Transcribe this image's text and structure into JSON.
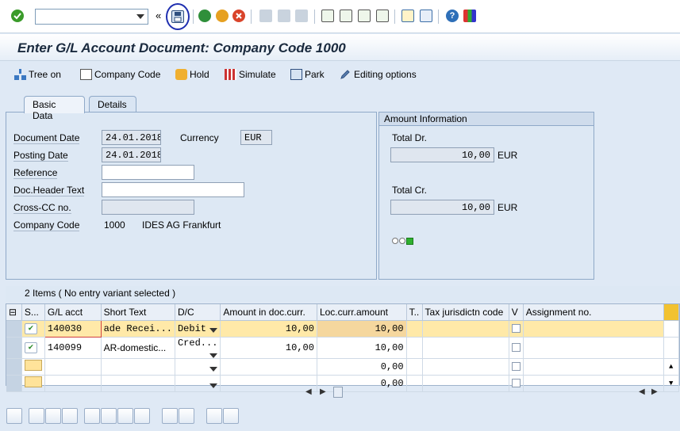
{
  "toolbar": {
    "command_value": "",
    "icons": [
      "enter-icon",
      "save-icon",
      "back-icon",
      "exit-icon",
      "cancel-icon",
      "print-icon",
      "find-icon",
      "find-next-icon",
      "first-page-icon",
      "prev-page-icon",
      "next-page-icon",
      "last-page-icon",
      "new-session-icon",
      "shortcut-icon",
      "help-icon",
      "customize-icon"
    ],
    "colors": {
      "enter": "#3a9b2a",
      "back": "#2f8f3a",
      "exit": "#e6a020",
      "cancel": "#d9442a",
      "help": "#2e6fb8",
      "highlight_ring": "#1f2fb0"
    }
  },
  "title": "Enter G/L Account Document: Company Code 1000",
  "app_toolbar": {
    "tree_on": "Tree on",
    "company_code": "Company Code",
    "hold": "Hold",
    "simulate": "Simulate",
    "park": "Park",
    "editing_options": "Editing options"
  },
  "tabs": {
    "basic": "Basic Data",
    "details": "Details"
  },
  "basic": {
    "doc_date_label": "Document Date",
    "doc_date": "24.01.2018",
    "currency_label": "Currency",
    "currency": "EUR",
    "posting_date_label": "Posting Date",
    "posting_date": "24.01.2018",
    "reference_label": "Reference",
    "reference": "",
    "header_text_label": "Doc.Header Text",
    "header_text": "",
    "cross_cc_label": "Cross-CC no.",
    "cross_cc": "",
    "company_code_label": "Company Code",
    "company_code": "1000",
    "company_name": "IDES AG Frankfurt"
  },
  "amount": {
    "title": "Amount Information",
    "total_dr_label": "Total Dr.",
    "total_dr": "10,00",
    "total_dr_cur": "EUR",
    "total_cr_label": "Total Cr.",
    "total_cr": "10,00",
    "total_cr_cur": "EUR",
    "status_light": "green"
  },
  "items": {
    "summary": "2 Items ( No entry variant selected )",
    "columns": [
      "S...",
      "G/L acct",
      "Short Text",
      "D/C",
      "Amount in doc.curr.",
      "Loc.curr.amount",
      "T..",
      "Tax jurisdictn code",
      "V",
      "Assignment no."
    ],
    "rows": [
      {
        "status": "ok",
        "gl": "140030",
        "short_text": "ade Recei...",
        "dc": "Debit",
        "amount": "10,00",
        "loc_amount": "10,00"
      },
      {
        "status": "ok",
        "gl": "140099",
        "short_text": "AR-domestic...",
        "dc": "Cred...",
        "amount": "10,00",
        "loc_amount": "10,00"
      },
      {
        "status": "empty",
        "gl": "",
        "short_text": "",
        "dc": "",
        "amount": "",
        "loc_amount": "0,00"
      },
      {
        "status": "empty",
        "gl": "",
        "short_text": "",
        "dc": "",
        "amount": "",
        "loc_amount": "0,00"
      }
    ]
  }
}
